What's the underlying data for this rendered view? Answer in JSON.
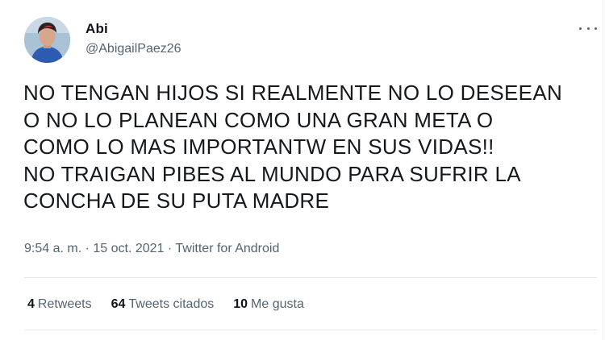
{
  "tweet": {
    "display_name": "Abi",
    "handle": "@AbigailPaez26",
    "text_lines": [
      "NO TENGAN HIJOS SI REALMENTE NO LO DESEEAN",
      "O NO LO PLANEAN COMO UNA GRAN META O",
      "COMO LO MAS IMPORTANTW EN SUS VIDAS!!",
      "NO TRAIGAN PIBES AL MUNDO PARA SUFRIR LA",
      "CONCHA DE SU PUTA MADRE"
    ],
    "time": "9:54 a. m.",
    "separator": "·",
    "date": "15 oct. 2021",
    "source": "Twitter for Android"
  },
  "stats": {
    "retweets_count": "4",
    "retweets_label": "Retweets",
    "quotes_count": "64",
    "quotes_label": "Tweets citados",
    "likes_count": "10",
    "likes_label": "Me gusta"
  },
  "icons": {
    "more": "more-options-icon"
  }
}
